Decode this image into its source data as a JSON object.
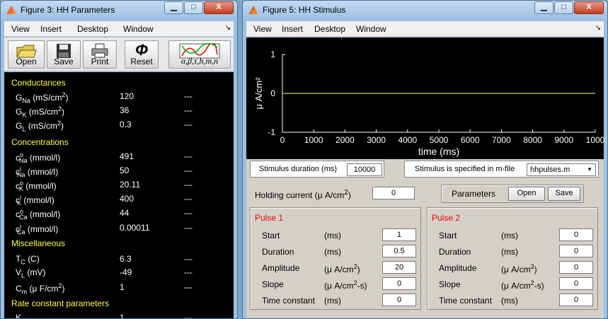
{
  "window_params": {
    "title": "Figure 3: HH Parameters",
    "menu": [
      "View",
      "Insert",
      "Desktop",
      "Window"
    ],
    "toolbar": {
      "open": "Open",
      "save": "Save",
      "print": "Print",
      "reset": "Reset",
      "reset_symbol": "Φ",
      "rates": "α,β,τ,h,m,n"
    },
    "sections": {
      "conductances": "Conductances",
      "concentrations": "Concentrations",
      "misc": "Miscellaneous",
      "rates": "Rate constant parameters"
    },
    "params": [
      {
        "base": "G",
        "sub": "Na",
        "unit": "(mS/cm",
        "sup": "2",
        "close": ")",
        "value": "120",
        "dash": "---"
      },
      {
        "base": "G",
        "sub": "K",
        "unit": "(mS/cm",
        "sup": "2",
        "close": ")",
        "value": "36",
        "dash": "---"
      },
      {
        "base": "G",
        "sub": "L",
        "unit": "(mS/cm",
        "sup": "2",
        "close": ")",
        "value": "0.3",
        "dash": "---"
      },
      {
        "base": "c",
        "sub": "Na",
        "supl": "o",
        "unit": "(mmol/l)",
        "value": "491",
        "dash": "---"
      },
      {
        "base": "c",
        "sub": "Na",
        "supl": "i",
        "unit": "(mmol/l)",
        "value": "50",
        "dash": "---"
      },
      {
        "base": "c",
        "sub": "K",
        "supl": "o",
        "unit": "(mmol/l)",
        "value": "20.11",
        "dash": "---"
      },
      {
        "base": "c",
        "sub": "K",
        "supl": "i",
        "unit": "(mmol/l)",
        "value": "400",
        "dash": "---"
      },
      {
        "base": "c",
        "sub": "Ca",
        "supl": "o",
        "unit": "(mmol/l)",
        "value": "44",
        "dash": "---"
      },
      {
        "base": "c",
        "sub": "Ca",
        "supl": "i",
        "unit": "(mmol/l)",
        "value": "0.00011",
        "dash": "---"
      },
      {
        "base": "T",
        "sub": "C",
        "unit": "(C)",
        "value": "6.3",
        "dash": "---"
      },
      {
        "base": "V",
        "sub": "L",
        "unit": "(mV)",
        "value": "-49",
        "dash": "---"
      },
      {
        "base": "C",
        "sub": "m",
        "unit": "(μ F/cm",
        "sup": "2",
        "close": ")",
        "value": "1",
        "dash": "---"
      },
      {
        "base": "K",
        "sub": "",
        "unit": "",
        "value": "1",
        "dash": "---"
      }
    ]
  },
  "window_stim": {
    "title": "Figure 5: HH Stimulus",
    "menu": [
      "View",
      "Insert",
      "Desktop",
      "Window"
    ],
    "chart_data": {
      "type": "line",
      "x": [
        0,
        10000
      ],
      "series": [
        {
          "values": [
            0,
            0
          ],
          "color": "#a6b04a"
        }
      ],
      "xlabel": "time (ms)",
      "ylabel": "μ A/cm²",
      "xlim": [
        0,
        10000
      ],
      "ylim": [
        -1,
        1
      ],
      "xticks": [
        "0",
        "1000",
        "2000",
        "3000",
        "4000",
        "5000",
        "6000",
        "7000",
        "8000",
        "9000",
        "1000"
      ],
      "yticks": [
        "1",
        "0",
        "-1"
      ]
    },
    "duration_label": "Stimulus duration (ms)",
    "duration_value": "10000",
    "mfile_label": "Stimulus is specified in m-file",
    "mfile_value": "hhpulses.m",
    "holding_label": "Holding current (μ A/cm",
    "holding_sup": "2",
    "holding_close": ")",
    "holding_value": "0",
    "params_label": "Parameters",
    "open_label": "Open",
    "save_label": "Save",
    "pulses": [
      {
        "title": "Pulse 1",
        "rows": [
          {
            "name": "Start",
            "unit": "(ms)",
            "value": "1"
          },
          {
            "name": "Duration",
            "unit": "(ms)",
            "value": "0.5"
          },
          {
            "name": "Amplitude",
            "unit": "(μ A/cm",
            "sup": "2",
            "close": ")",
            "value": "20"
          },
          {
            "name": "Slope",
            "unit": "(μ A/cm",
            "sup": "2",
            "close": "-s)",
            "value": "0"
          },
          {
            "name": "Time constant",
            "unit": "(ms)",
            "value": "0"
          }
        ]
      },
      {
        "title": "Pulse 2",
        "rows": [
          {
            "name": "Start",
            "unit": "(ms)",
            "value": "0"
          },
          {
            "name": "Duration",
            "unit": "(ms)",
            "value": "0"
          },
          {
            "name": "Amplitude",
            "unit": "(μ A/cm",
            "sup": "2",
            "close": ")",
            "value": "0"
          },
          {
            "name": "Slope",
            "unit": "(μ A/cm",
            "sup": "2",
            "close": "-s)",
            "value": "0"
          },
          {
            "name": "Time constant",
            "unit": "(ms)",
            "value": "0"
          }
        ]
      }
    ]
  },
  "titlebar_buttons": {
    "min": "▁",
    "max": "□",
    "close": "X"
  }
}
